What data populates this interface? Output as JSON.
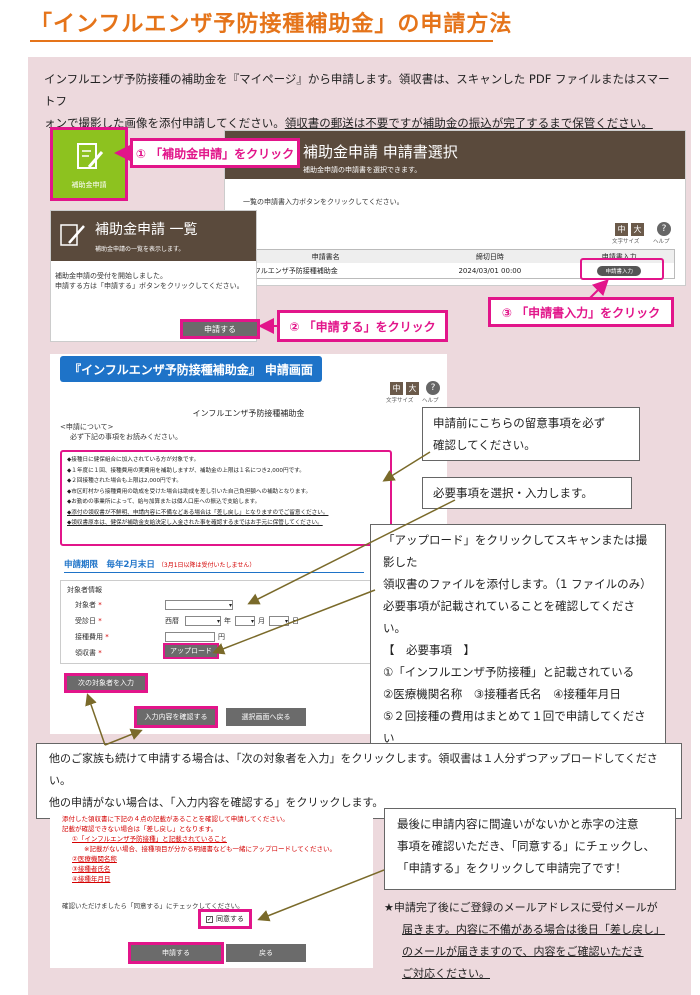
{
  "title": "「インフルエンザ予防接種補助金」の申請方法",
  "intro": {
    "line1": "インフルエンザ予防接種の補助金を『マイページ』から申請します。領収書は、スキャンした PDF ファイルまたはスマートフ",
    "line2a": "ォンで撮影した画像を添付申請してください。",
    "line2b": "領収書の郵送は不要ですが補助金の振込が完了するまで保管ください。"
  },
  "shot1": {
    "tile_label": "補助金申請",
    "header_title": "補助金申請 申請書選択",
    "header_sub": "補助金申請の申請書を選択できます。",
    "instruction": "一覧の申請書入力ボタンをクリックしてください。",
    "size_small": "中",
    "size_large": "大",
    "size_label": "文字サイズ",
    "help": "?",
    "help_label": "ヘルプ",
    "table_headers": [
      "申請書名",
      "締切日時",
      "申請書入力"
    ],
    "table_row": [
      "インフルエンザ予防接種補助金",
      "2024/03/01 00:00",
      "申請書入力"
    ]
  },
  "shot2": {
    "header_title": "補助金申請 一覧",
    "header_sub": "補助金申請の一覧を表示します。",
    "text1": "補助金申請の受付を開始しました。",
    "text2": "申請する方は「申請する」ボタンをクリックしてください。",
    "apply_button": "申請する"
  },
  "steps": {
    "step1": "① 「補助金申請」をクリック",
    "step2": "② 「申請する」をクリック",
    "step3": "③ 「申請書入力」をクリック"
  },
  "form": {
    "banner": "『インフルエンザ予防接種補助金』 申請画面",
    "size_small": "中",
    "size_large": "大",
    "size_label": "文字サイズ",
    "help": "?",
    "help_label": "ヘルプ",
    "form_title": "インフルエンザ予防接種補助金",
    "about": "<申請について>",
    "about_sub": "必ず下記の事項をお読みください。",
    "notes": [
      "◆接種日に健保組合に加入されている方が対象です。",
      "◆１年度に１回、接種費用の実費用を補助しますが、補助金の上限は１名につき2,000円です。",
      "◆２回接種された場合も上限は2,000円です。",
      "◆市区町村から接種費用の助成を受けた場合は助成を差し引いた自己負担額への補助となります。",
      "◆お勤めの事業所によって、給与加算または個人口座への振込で支給します。",
      "◆添付の領収書が不鮮明、申請内容に不備などある場合は「差し戻し」となりますのでご留意ください。",
      "◆領収書原本は、健保が補助金支給決定し入金された事を確認するまではお手元に保管してください。"
    ],
    "deadline": "申請期限　毎年2月末日",
    "deadline_note": "（3月1日以降は受付いたしません）",
    "subject_info": "対象者情報",
    "label_subject": "対象者",
    "label_date": "受診日",
    "era": "西暦",
    "unit_year": "年",
    "unit_month": "月",
    "unit_day": "日",
    "label_cost": "接種費用",
    "unit_yen": "円",
    "label_receipt": "領収書",
    "required_mark": "*",
    "upload_button": "アップロード",
    "next_subject_button": "次の対象者を入力",
    "confirm_button": "入力内容を確認する",
    "back_button": "選択画面へ戻る"
  },
  "callouts": {
    "notes_check": [
      "申請前にこちらの留意事項を必ず",
      "確認してください。"
    ],
    "select_input": "必要事項を選択・入力します。",
    "upload_lines": [
      "「アップロード」をクリックしてスキャンまたは撮影した",
      "領収書のファイルを添付します。（1 ファイルのみ）",
      "必要事項が記載されていることを確認してください。",
      "【　必要事項　】",
      "①「インフルエンザ予防接種」と記載されている",
      "②医療機関名称　③接種者氏名　④接種年月日",
      "⑤２回接種の費用はまとめて１回で申請してください"
    ],
    "family_lines": [
      "他のご家族も続けて申請する場合は、「次の対象者を入力」をクリックします。領収書は１人分ずつアップロードしてください。",
      "他の申請がない場合は、「入力内容を確認する」をクリックします。"
    ],
    "final_lines": [
      "最後に申請内容に間違いがないかと赤字の注意",
      "事項を確認いただき、「同意する」にチェックし、",
      "「申請する」をクリックして申請完了です！"
    ],
    "star_lines": [
      "★申請完了後にご登録のメールアドレスに受付メールが",
      "届きます。内容に不備がある場合は後日「差し戻し」",
      "のメールが届きますので、内容をご確認いただき",
      "ご対応ください。"
    ]
  },
  "confirm": {
    "lines": [
      "添付した領収書に下記の４点の記載があることを確認して申請してください。",
      "記載が確認できない場合は「差し戻し」となります。",
      "①「インフルエンザ予防接種」と記載されていること",
      "※記載がない場合、接種項目が分かる明細書なども一緒にアップロードしてください。",
      "②医療機関名称",
      "③接種者氏名",
      "④接種年月日"
    ],
    "agree_prompt": "確認いただけましたら「同意する」にチェックしてください。",
    "agree_label": "同意する",
    "submit_button": "申請する",
    "back_button": "戻る"
  },
  "colors": {
    "accent": "#e5741a",
    "pink": "#e2158a",
    "panel": "#edd9dd",
    "brown": "#5a4a3c",
    "blue": "#1e73c8",
    "green": "#8dc21f"
  }
}
